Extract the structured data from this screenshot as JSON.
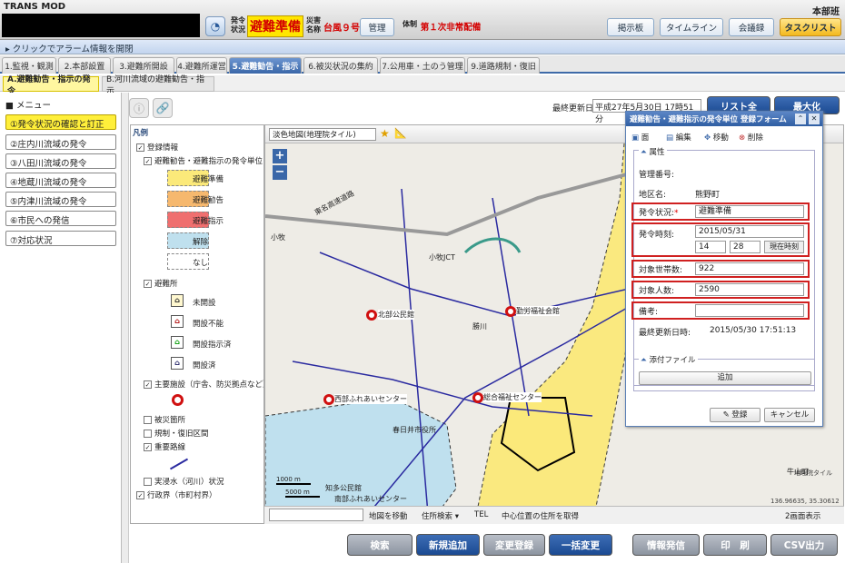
{
  "app": {
    "title": "TRANS MOD",
    "unit": "本部班"
  },
  "status": {
    "hatsurei_label": "発令\n状況",
    "hatsurei_value": "避難準備",
    "saigai_label": "災害\n名称",
    "saigai_value": "台風９号",
    "kanri": "管理",
    "taisei_label": "体制",
    "taisei_value": "第１次非常配備"
  },
  "top_buttons": [
    "掲示板",
    "タイムライン",
    "会議録",
    "タスクリスト"
  ],
  "alarm": "▸ クリックでアラーム情報を開閉",
  "tabs": [
    "1.監視・観測",
    "2.本部設置",
    "3.避難所開設",
    "4.避難所運営",
    "5.避難勧告・指示",
    "6.被災状況の集約",
    "7.公用車・土のう管理",
    "9.道路規制・復旧"
  ],
  "subtabs": [
    "A.避難勧告・指示の発令",
    "B.河川流域の避難勧告・指示"
  ],
  "menu": {
    "title": "■ メニュー",
    "items": [
      "①発令状況の確認と訂正",
      "②庄内川流域の発令",
      "③八田川流域の発令",
      "④地蔵川流域の発令",
      "⑤内津川流域の発令",
      "⑥市民への発信",
      "⑦対応状況"
    ]
  },
  "last_updated": {
    "label": "最終更新日",
    "value": "平成27年5月30日 17時51分"
  },
  "header_buttons": [
    "リスト全",
    "最大化"
  ],
  "legend": {
    "title": "凡例",
    "root": "登録情報",
    "group1": "避難勧告・避難指示の発令単位",
    "zones": [
      "避難準備",
      "避難勧告",
      "避難指示",
      "解除",
      "なし"
    ],
    "group2": "避難所",
    "shelters": [
      "未開設",
      "開設不能",
      "開設指示済",
      "開設済"
    ],
    "group3": "主要施設（庁舎、防災拠点など）",
    "others": [
      "被災箇所",
      "規制・復旧区間",
      "重要路線",
      "実浸水（河川）状況",
      "行政界（市町村界）"
    ]
  },
  "map": {
    "layer": "淡色地図(地理院タイル)",
    "labels": [
      "東名高速道路",
      "小牧JCT",
      "勝川",
      "北部公民館",
      "勤労福祉会館",
      "西部ふれあいセンター",
      "総合福祉センター",
      "春日井市役所",
      "知多公民館",
      "南部ふれあいセンター",
      "牛山町",
      "小牧",
      "1000 m",
      "5000 m",
      "地理院タイル",
      "136.96635, 35.30612"
    ],
    "bottom": [
      "地図を移動",
      "住所検索 ▾",
      "TEL",
      "中心位置の住所を取得",
      "2画面表示"
    ]
  },
  "form": {
    "title": "避難勧告・避難指示の発令単位 登録フォーム",
    "toolbar": [
      "面",
      "編集",
      "移動",
      "削除"
    ],
    "section": "属性",
    "kanri_label": "管理番号:",
    "chiku_label": "地区名:",
    "chiku_value": "熊野町",
    "jokyo_label": "発令状況:",
    "jokyo_value": "避難準備",
    "jiko_label": "発令時刻:",
    "date": "2015/05/31",
    "hour": "14",
    "minute": "28",
    "now_button": "現在時刻",
    "setai_label": "対象世帯数:",
    "setai_value": "922",
    "jinin_label": "対象人数:",
    "jinin_value": "2590",
    "biko_label": "備考:",
    "updated_label": "最終更新日時:",
    "updated_value": "2015/05/30 17:51:13",
    "attach_section": "添付ファイル",
    "add_button": "追加",
    "register_button": "登録",
    "cancel_button": "キャンセル"
  },
  "bottom_buttons": [
    "検索",
    "新規追加",
    "変更登録",
    "一括変更",
    "情報発信",
    "印　刷",
    "CSV出力"
  ],
  "colors": {
    "junbi": "#fbe97a",
    "kankoku": "#f6b86e",
    "shiji": "#ef6f6f",
    "kaijo": "#bfe0ee",
    "accent": "#3a67a8"
  }
}
